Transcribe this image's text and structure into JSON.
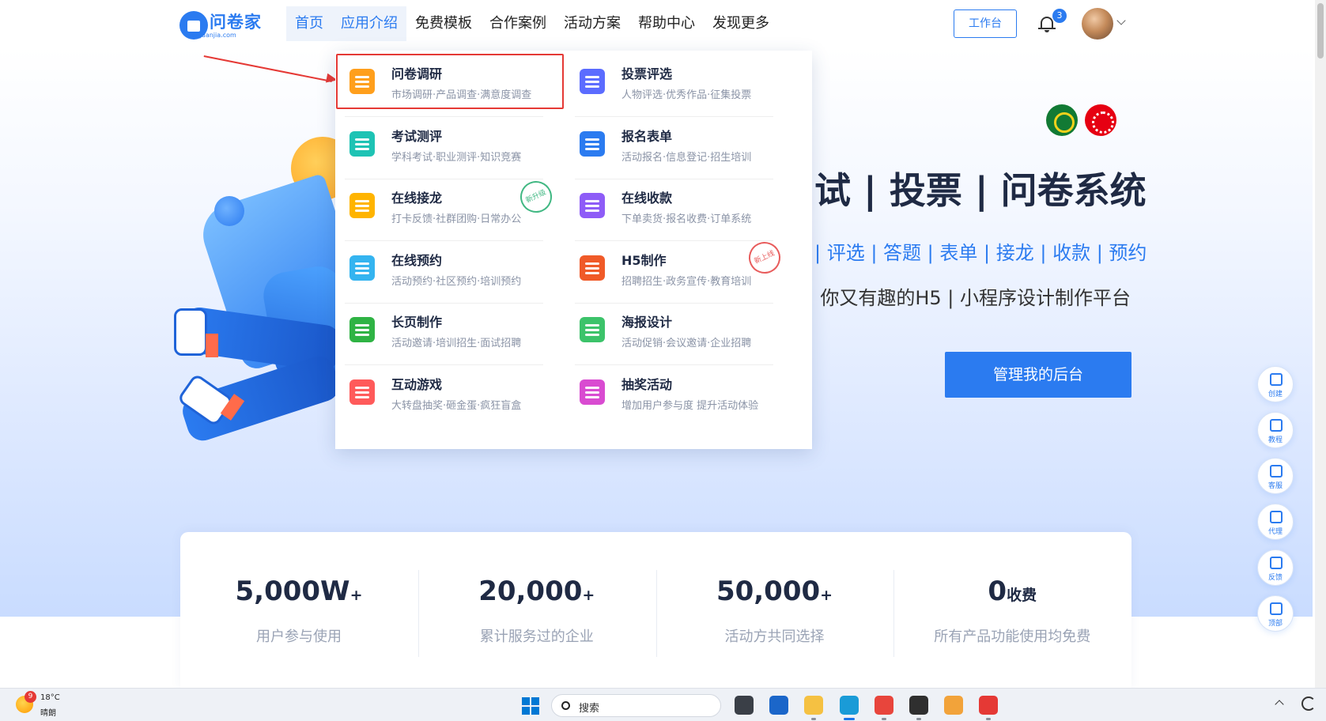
{
  "brand": {
    "name": "问卷家",
    "domain": "wenjuanjia.com",
    "color": "#2b7bf0"
  },
  "nav": [
    {
      "label": "首页",
      "state": "active"
    },
    {
      "label": "应用介绍",
      "state": "hover"
    },
    {
      "label": "免费模板",
      "state": ""
    },
    {
      "label": "合作案例",
      "state": ""
    },
    {
      "label": "活动方案",
      "state": ""
    },
    {
      "label": "帮助中心",
      "state": ""
    },
    {
      "label": "发现更多",
      "state": ""
    }
  ],
  "header": {
    "workbench_label": "工作台",
    "notification_count": "3"
  },
  "hero": {
    "title": "试 | 投票 | 问卷系统",
    "links": "| 评选 | 答题 | 表单 | 接龙 | 收款 | 预约",
    "subtitle": "你又有趣的H5 | 小程序设计制作平台",
    "cta_label": "管理我的后台"
  },
  "dropdown": {
    "items": [
      {
        "title": "问卷调研",
        "desc": "市场调研·产品调查·满意度调查",
        "icon": "survey-icon",
        "color": "#ff9f1c",
        "highlighted": true
      },
      {
        "title": "投票评选",
        "desc": "人物评选·优秀作品·征集投票",
        "icon": "vote-icon",
        "color": "#5b6cff"
      },
      {
        "title": "考试测评",
        "desc": "学科考试·职业测评·知识竞赛",
        "icon": "exam-icon",
        "color": "#1ec3b4"
      },
      {
        "title": "报名表单",
        "desc": "活动报名·信息登记·招生培训",
        "icon": "form-icon",
        "color": "#2b7bf0"
      },
      {
        "title": "在线接龙",
        "desc": "打卡反馈·社群团购·日常办公",
        "icon": "relay-icon",
        "color": "#ffb400",
        "stamp": "新升级"
      },
      {
        "title": "在线收款",
        "desc": "下单卖货·报名收费·订单系统",
        "icon": "payment-icon",
        "color": "#8e5cf7"
      },
      {
        "title": "在线预约",
        "desc": "活动预约·社区预约·培训预约",
        "icon": "calendar-icon",
        "color": "#34b4f0"
      },
      {
        "title": "H5制作",
        "desc": "招聘招生·政务宣传·教育培训",
        "icon": "html5-icon",
        "color": "#f05a28",
        "stamp": "新上线"
      },
      {
        "title": "长页制作",
        "desc": "活动邀请·培训招生·面试招聘",
        "icon": "longpage-icon",
        "color": "#2fb344"
      },
      {
        "title": "海报设计",
        "desc": "活动促销·会议邀请·企业招聘",
        "icon": "poster-icon",
        "color": "#3cc36a"
      },
      {
        "title": "互动游戏",
        "desc": "大转盘抽奖·砸金蛋·疯狂盲盒",
        "icon": "gift-icon",
        "color": "#ff5a5a"
      },
      {
        "title": "抽奖活动",
        "desc": "增加用户参与度 提升活动体验",
        "icon": "lottery-wheel-icon",
        "color": "#d94bd1"
      }
    ]
  },
  "stats": [
    {
      "value": "5,000W",
      "suffix": "+",
      "label": "用户参与使用"
    },
    {
      "value": "20,000",
      "suffix": "+",
      "label": "累计服务过的企业"
    },
    {
      "value": "50,000",
      "suffix": "+",
      "label": "活动方共同选择"
    },
    {
      "value": "0",
      "suffix": "收费",
      "label": "所有产品功能使用均免费"
    }
  ],
  "side_tools": [
    {
      "label": "创建",
      "icon": "create-icon"
    },
    {
      "label": "教程",
      "icon": "tutorial-icon"
    },
    {
      "label": "客服",
      "icon": "headset-icon"
    },
    {
      "label": "代理",
      "icon": "agent-icon"
    },
    {
      "label": "反馈",
      "icon": "edit-icon"
    },
    {
      "label": "顶部",
      "icon": "to-top-icon"
    }
  ],
  "taskbar": {
    "weather_badge": "9",
    "temperature": "18°C",
    "weather_desc": "晴朗",
    "search_placeholder": "搜索",
    "apps": [
      {
        "icon": "task-view-icon",
        "color": "#3a3f47"
      },
      {
        "icon": "store-icon",
        "color": "#1b66c9"
      },
      {
        "icon": "file-explorer-icon",
        "color": "#f5c142"
      },
      {
        "icon": "edge-icon",
        "color": "#1a9bd7",
        "active": true
      },
      {
        "icon": "chrome-icon",
        "color": "#e8453c"
      },
      {
        "icon": "sticky-notes-icon",
        "color": "#2f2f2f"
      },
      {
        "icon": "app-icon",
        "color": "#f2a33a"
      },
      {
        "icon": "wps-icon",
        "color": "#e53935"
      }
    ]
  }
}
